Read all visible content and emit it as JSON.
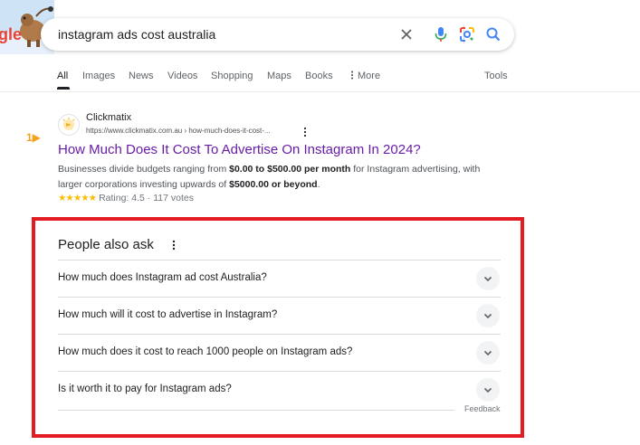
{
  "search": {
    "query": "instagram ads cost australia",
    "icons": [
      "clear-icon",
      "mic-icon",
      "lens-icon",
      "search-icon"
    ]
  },
  "logo": {
    "text": "gle"
  },
  "tabs": [
    {
      "label": "All",
      "active": true
    },
    {
      "label": "Images"
    },
    {
      "label": "News"
    },
    {
      "label": "Videos"
    },
    {
      "label": "Shopping"
    },
    {
      "label": "Maps"
    },
    {
      "label": "Books"
    },
    {
      "label": "More",
      "icon": "kebab-icon"
    },
    {
      "label": "Tools"
    }
  ],
  "result": {
    "marker": "1▶",
    "site_name": "Clickmatix",
    "url": "https://www.clickmatix.com.au › how-much-does-it-cost-...",
    "title": "How Much Does It Cost To Advertise On Instagram In 2024?",
    "snippet_pre": "Businesses divide budgets ranging from ",
    "snippet_bold": "$0.00 to $500.00 per month",
    "snippet_mid": " for Instagram advertising, with larger corporations investing upwards of ",
    "snippet_bold2": "$5000.00 or beyond",
    "snippet_end": ".",
    "stars": "★★★★★",
    "rating_text": "Rating: 4.5 · 117 votes"
  },
  "paa": {
    "title": "People also ask",
    "questions": [
      "How much does Instagram ad cost Australia?",
      "How much will it cost to advertise in Instagram?",
      "How much does it cost to reach 1000 people on Instagram ads?",
      "Is it worth it to pay for Instagram ads?"
    ],
    "feedback": "Feedback"
  },
  "colors": {
    "highlight": "#e31b23",
    "visited_link": "#681da8",
    "marker": "#f4a11c"
  }
}
